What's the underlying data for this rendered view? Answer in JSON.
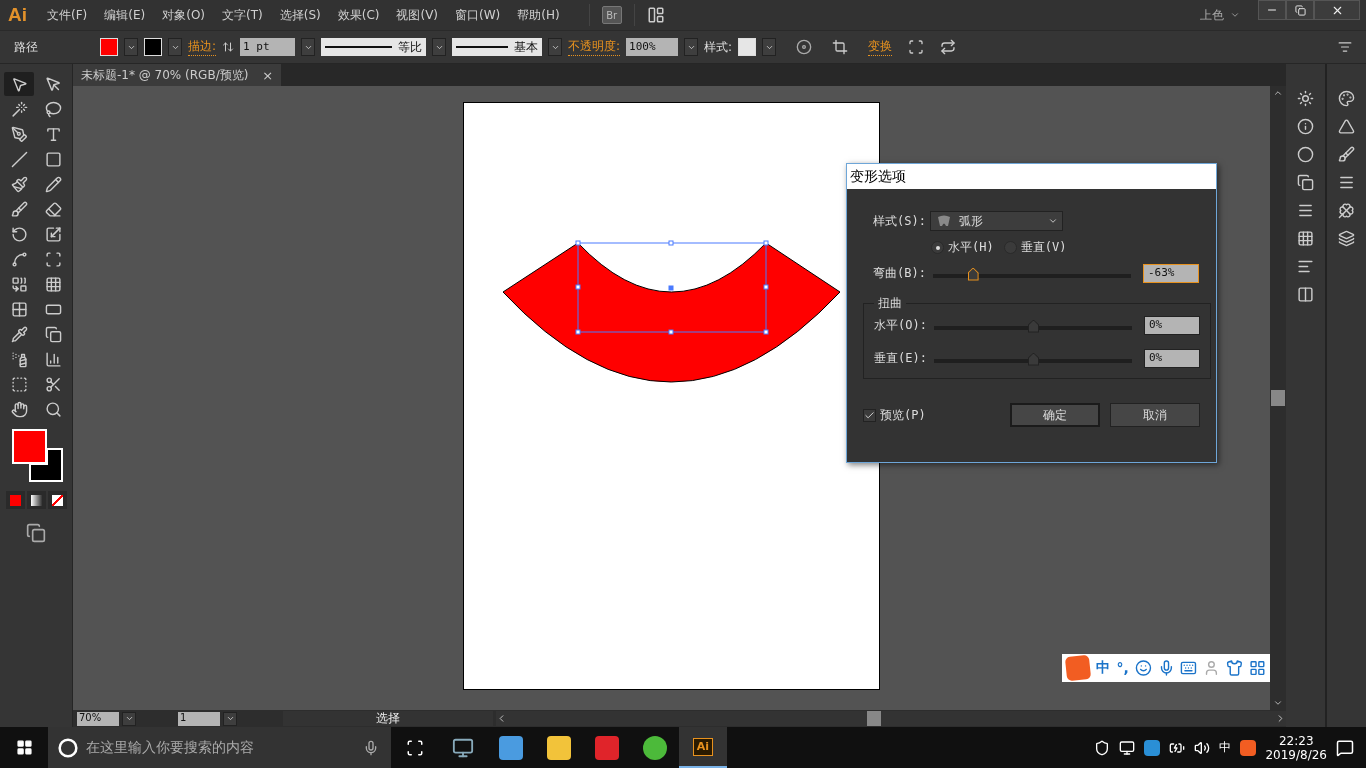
{
  "menu_bar": {
    "app_logo": "Ai",
    "menus": [
      "文件(F)",
      "编辑(E)",
      "对象(O)",
      "文字(T)",
      "选择(S)",
      "效果(C)",
      "视图(V)",
      "窗口(W)",
      "帮助(H)"
    ],
    "bridge": "Br",
    "workspace": "上色"
  },
  "control_bar": {
    "object_type": "路径",
    "stroke_label": "描边:",
    "stroke_weight": "1 pt",
    "profile": "等比",
    "brush": "基本",
    "opacity_label": "不透明度:",
    "opacity": "100%",
    "style_label": "样式:",
    "transform_label": "变换"
  },
  "tools": [
    {
      "selected": true
    },
    {
      "selected": false
    },
    {
      "selected": false
    },
    {
      "selected": false
    },
    {
      "selected": false
    },
    {
      "selected": false
    },
    {
      "selected": false
    },
    {
      "selected": false
    },
    {
      "selected": false
    },
    {
      "selected": false
    },
    {
      "selected": false
    },
    {
      "selected": false
    },
    {
      "selected": false
    },
    {
      "selected": false
    },
    {
      "selected": false
    },
    {
      "selected": false
    },
    {
      "selected": false
    },
    {
      "selected": false
    },
    {
      "selected": false
    },
    {
      "selected": false
    },
    {
      "selected": false
    },
    {
      "selected": false
    },
    {
      "selected": false
    },
    {
      "selected": false
    },
    {
      "selected": false
    },
    {
      "selected": false
    },
    {
      "selected": false
    },
    {
      "selected": false
    }
  ],
  "document_tab": {
    "title": "未标题-1* @ 70% (RGB/预览)",
    "close": "×"
  },
  "dialog": {
    "title": "变形选项",
    "style_label": "样式(S):",
    "style_value": "弧形",
    "orientation": [
      {
        "label": "水平(H)",
        "selected": true
      },
      {
        "label": "垂直(V)",
        "selected": false
      }
    ],
    "bend": {
      "label": "弯曲(B):",
      "level": 0.2,
      "value": "-63%"
    },
    "distortion": {
      "title": "扭曲",
      "rows": [
        {
          "label": "水平(O):",
          "level": 0.5,
          "value": "0%"
        },
        {
          "label": "垂直(E):",
          "level": 0.5,
          "value": "0%"
        }
      ]
    },
    "preview": {
      "label": "预览(P)",
      "checked": true
    },
    "buttons": [
      "确定",
      "取消"
    ]
  },
  "status_bar": {
    "zoom": "70%",
    "artboard": "1",
    "tool": "选择"
  },
  "ime_bar": {
    "mode": "中",
    "punctuation": "°,"
  },
  "taskbar": {
    "search_placeholder": "在这里输入你要搜索的内容",
    "app_label": "Ai",
    "ime": "中",
    "time": "22:23",
    "date": "2019/8/26"
  }
}
